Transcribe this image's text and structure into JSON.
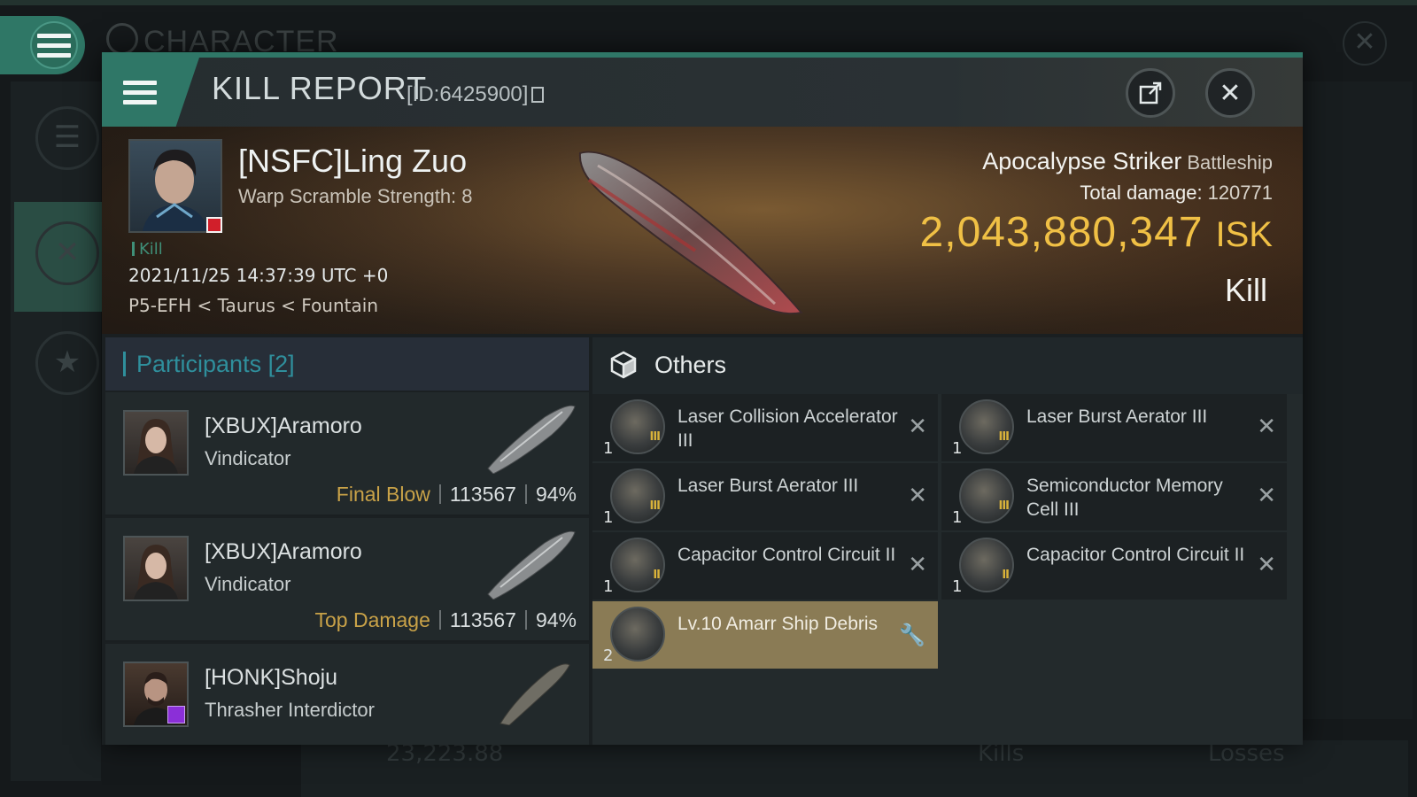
{
  "background": {
    "title": "CHARACTER",
    "bottom_value": "23,223.88",
    "bottom_kills": "Kills",
    "bottom_losses": "Losses"
  },
  "header": {
    "title": "KILL REPORT",
    "id_text": "[ID:6425900]"
  },
  "victim": {
    "name": "[NSFC]Ling Zuo",
    "subtitle": "Warp Scramble Strength: 8",
    "tag": "Kill",
    "timestamp": "2021/11/25 14:37:39 UTC +0",
    "location": "P5-EFH < Taurus < Fountain",
    "ship_name": "Apocalypse Striker",
    "ship_class": "Battleship",
    "total_damage_label": "Total damage:",
    "total_damage": "120771",
    "isk_value": "2,043,880,347",
    "isk_unit": "ISK",
    "result": "Kill"
  },
  "participants": {
    "header": "Participants [2]",
    "rows": [
      {
        "name": "[XBUX]Aramoro",
        "ship": "Vindicator",
        "tag": "Final Blow",
        "damage": "113567",
        "percent": "94%"
      },
      {
        "name": "[XBUX]Aramoro",
        "ship": "Vindicator",
        "tag": "Top Damage",
        "damage": "113567",
        "percent": "94%"
      },
      {
        "name": "[HONK]Shoju",
        "ship": "Thrasher Interdictor",
        "tag": "",
        "damage": "",
        "percent": ""
      }
    ]
  },
  "others": {
    "title": "Others",
    "items": [
      {
        "name": "Laser Collision Accelerator III",
        "qty": "1",
        "mark": "III",
        "status": "destroyed"
      },
      {
        "name": "Laser Burst Aerator III",
        "qty": "1",
        "mark": "III",
        "status": "destroyed"
      },
      {
        "name": "Laser Burst Aerator III",
        "qty": "1",
        "mark": "III",
        "status": "destroyed"
      },
      {
        "name": "Semiconductor Memory Cell III",
        "qty": "1",
        "mark": "III",
        "status": "destroyed"
      },
      {
        "name": "Capacitor Control Circuit II",
        "qty": "1",
        "mark": "II",
        "status": "destroyed"
      },
      {
        "name": "Capacitor Control Circuit II",
        "qty": "1",
        "mark": "II",
        "status": "destroyed"
      },
      {
        "name": "Lv.10 Amarr Ship Debris",
        "qty": "2",
        "mark": "",
        "status": "dropped"
      }
    ]
  },
  "colors": {
    "accent_green": "#2f7767",
    "isk_gold": "#f0c045",
    "participant_tag_gold": "#c9a248",
    "highlight_item": "#8a7b55"
  }
}
